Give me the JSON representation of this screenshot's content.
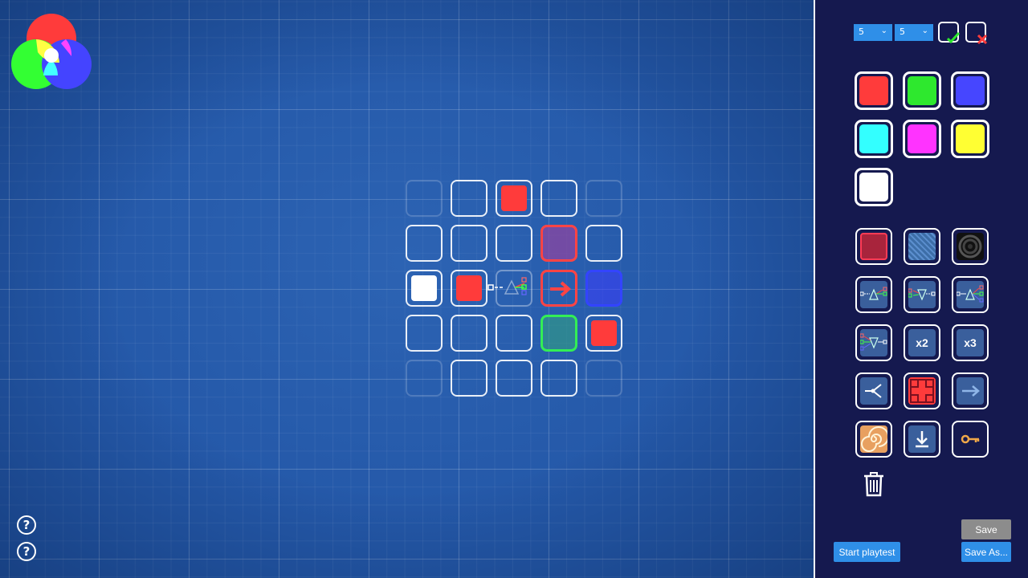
{
  "toolbar": {
    "width_value": "5",
    "height_value": "5",
    "confirm_icon": "check-icon",
    "cancel_icon": "x-icon"
  },
  "palette": {
    "colors": [
      {
        "name": "red",
        "hex": "#ff3b3b"
      },
      {
        "name": "green",
        "hex": "#2ee82e"
      },
      {
        "name": "blue",
        "hex": "#4646ff"
      },
      {
        "name": "cyan",
        "hex": "#33ffff"
      },
      {
        "name": "magenta",
        "hex": "#ff33ff"
      },
      {
        "name": "yellow",
        "hex": "#ffff33"
      },
      {
        "name": "white",
        "hex": "#ffffff"
      }
    ],
    "pieces": [
      "dark-red-block-icon",
      "hatched-block-icon",
      "vortex-icon",
      "prism-combine-icon",
      "prism-split-icon",
      "prism-triple-icon",
      "prism-quad-icon",
      "multiplier-x2-icon",
      "multiplier-x3-icon",
      "splitter-icon",
      "crosshair-block-icon",
      "arrow-right-icon",
      "spiral-icon",
      "download-icon",
      "key-icon"
    ],
    "x2_label": "x2",
    "x3_label": "x3"
  },
  "actions": {
    "save_label": "Save",
    "save_as_label": "Save As...",
    "start_playtest_label": "Start playtest"
  },
  "colors": {
    "accent": "#2f8fe8",
    "panel_bg": "#15194f",
    "canvas_bg": "#2458a8",
    "disabled": "#8c8c8c"
  }
}
